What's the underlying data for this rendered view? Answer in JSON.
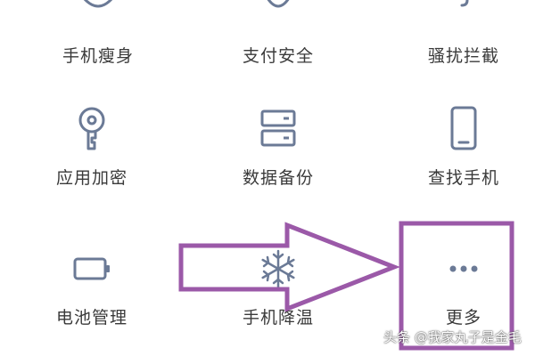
{
  "menu": {
    "items": [
      {
        "label": "手机瘦身",
        "icon": "broom-icon"
      },
      {
        "label": "支付安全",
        "icon": "shield-icon"
      },
      {
        "label": "骚扰拦截",
        "icon": "phone-block-icon"
      },
      {
        "label": "应用加密",
        "icon": "key-icon"
      },
      {
        "label": "数据备份",
        "icon": "server-icon"
      },
      {
        "label": "查找手机",
        "icon": "phone-icon"
      },
      {
        "label": "电池管理",
        "icon": "battery-icon"
      },
      {
        "label": "手机降温",
        "icon": "snowflake-icon"
      },
      {
        "label": "更多",
        "icon": "more-dots-icon"
      }
    ]
  },
  "annotation": {
    "arrow_color": "#9b59a8",
    "highlight_color": "#9b59a8"
  },
  "watermark": {
    "text": "头条 @我家丸子是金毛"
  },
  "colors": {
    "icon_stroke": "#6b7a96",
    "label": "#3a3a3a"
  }
}
